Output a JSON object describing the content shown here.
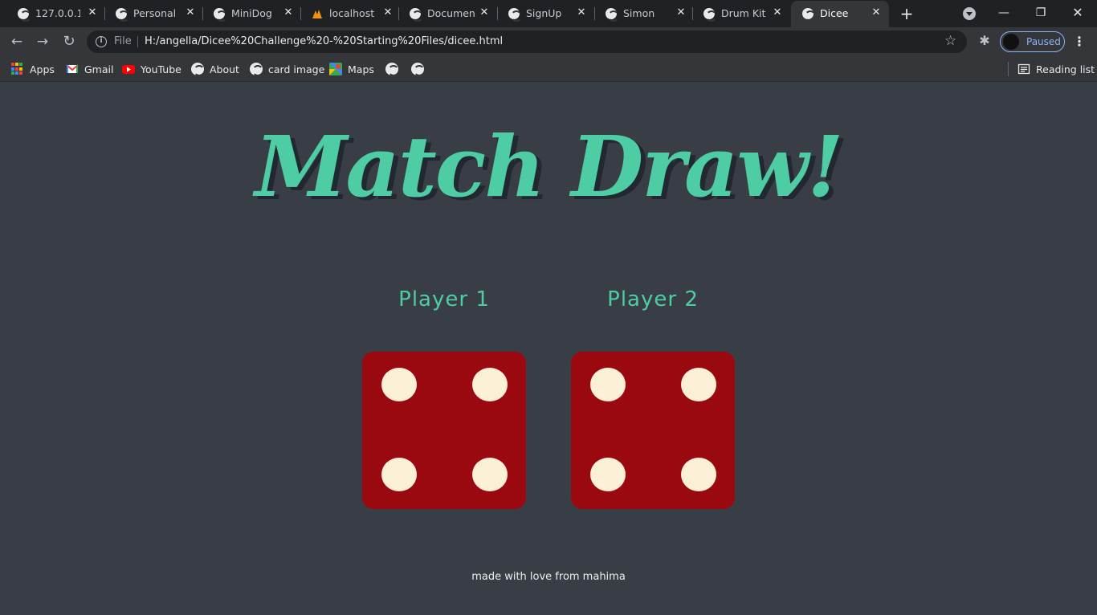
{
  "browser": {
    "tabs": [
      {
        "title": "127.0.0.1:5",
        "active": false
      },
      {
        "title": "Personal P",
        "active": false
      },
      {
        "title": "MiniDog",
        "active": false
      },
      {
        "title": "localhost /",
        "active": false
      },
      {
        "title": "Document",
        "active": false
      },
      {
        "title": "SignUp",
        "active": false
      },
      {
        "title": "Simon",
        "active": false
      },
      {
        "title": "Drum Kit",
        "active": false
      },
      {
        "title": "Dicee",
        "active": true
      }
    ],
    "new_tab_icon": "plus-icon",
    "address_bar": {
      "scheme_label": "File",
      "url": "H:/angella/Dicee%20Challenge%20-%20Starting%20Files/dicee.html"
    },
    "profile_label": "Paused",
    "bookmarks": [
      {
        "label": "Apps",
        "icon": "apps-grid-icon"
      },
      {
        "label": "Gmail",
        "icon": "gmail-icon"
      },
      {
        "label": "YouTube",
        "icon": "youtube-icon"
      },
      {
        "label": "About",
        "icon": "globe-icon"
      },
      {
        "label": "card image",
        "icon": "globe-icon"
      },
      {
        "label": "Maps",
        "icon": "maps-icon"
      },
      {
        "label": "",
        "icon": "globe-icon"
      },
      {
        "label": "",
        "icon": "globe-icon"
      }
    ],
    "reading_list_label": "Reading list"
  },
  "page": {
    "title": "Match Draw!",
    "player1_label": "Player 1",
    "player2_label": "Player 2",
    "player1_die": 4,
    "player2_die": 4,
    "footer": "made with love from mahima"
  },
  "colors": {
    "background": "#393e46",
    "accent": "#4ecca3",
    "die": "#9b0910",
    "pip": "#fbefd6"
  }
}
